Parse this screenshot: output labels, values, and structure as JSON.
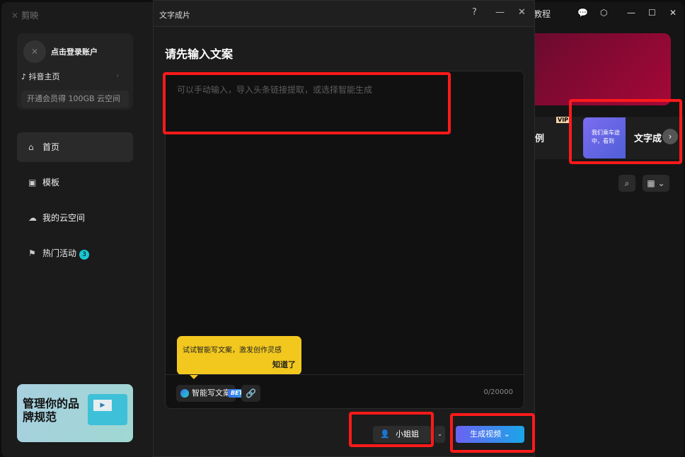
{
  "app": {
    "logo": "剪映",
    "login": "点击登录账户",
    "douyin": "抖音主页",
    "vip": "开通会员得 100GB 云空间",
    "nav": [
      {
        "label": "首页",
        "icon": "home-icon"
      },
      {
        "label": "模板",
        "icon": "template-icon"
      },
      {
        "label": "我的云空间",
        "icon": "cloud-icon"
      },
      {
        "label": "热门活动",
        "icon": "flag-icon",
        "badge": "3"
      }
    ],
    "banner": {
      "title": "管理你的品牌规范"
    },
    "topbar": {
      "tutorial": "教程"
    },
    "feature": {
      "partial_label": "例",
      "vip_tag": "VIP",
      "thumb_text": "我们乘车途中，看到",
      "title": "文字成"
    }
  },
  "dialog": {
    "title": "文字成片",
    "heading": "请先输入文案",
    "placeholder": "可以手动输入，导入头条链接提取，或选择智能生成",
    "tip": {
      "text": "试试智能写文案，激发创作灵感",
      "dismiss": "知道了"
    },
    "ai_write": "智能写文案",
    "beta": "BETA",
    "count": "0/20000",
    "voice": "小姐姐",
    "generate": "生成视频"
  },
  "colors": {
    "accent": "#19c6d1",
    "tip": "#f2c81f",
    "annotation": "#ff1a1a"
  }
}
